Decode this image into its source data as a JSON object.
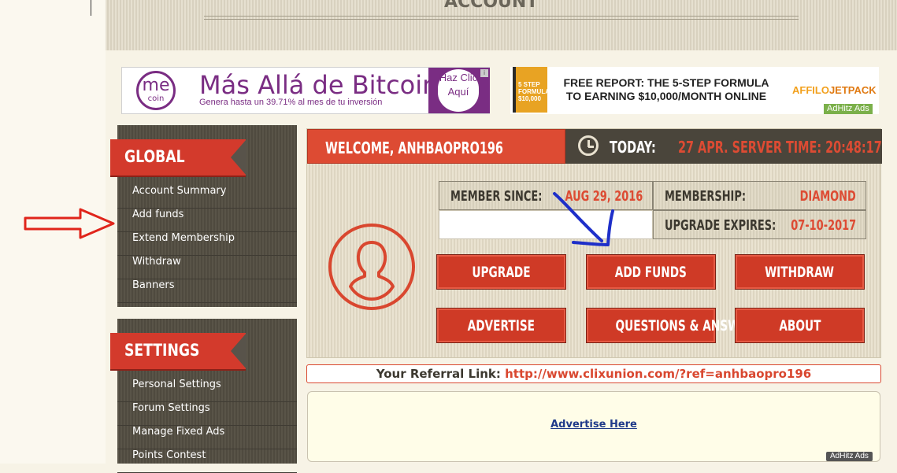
{
  "header": {
    "partial_title": "ACCOUNT"
  },
  "banner_left": {
    "logo_top": "me",
    "logo_bottom": "coin",
    "title": "Más Allá de Bitcoin",
    "subtitle": "Genera hasta un 39.71% al mes de tu inversión",
    "cta": "Haz Clic Aquí"
  },
  "banner_right": {
    "book_text": "5 STEP FORMULA $10,000",
    "headline_line1": "FREE REPORT: THE 5-STEP FORMULA",
    "headline_line2": "TO EARNING $10,000/MONTH ONLINE",
    "brand_left": "AFFILO",
    "brand_right": "JETPACK",
    "badge": "AdHitz Ads"
  },
  "sidebar": {
    "global_title": "GLOBAL",
    "global_items": [
      "Account Summary",
      "Add funds",
      "Extend Membership",
      "Withdraw",
      "Banners"
    ],
    "settings_title": "SETTINGS",
    "settings_items": [
      "Personal Settings",
      "Forum Settings",
      "Manage Fixed Ads",
      "Points Contest"
    ]
  },
  "main": {
    "welcome": "WELCOME, ANHBAOPRO196",
    "today_label": "TODAY:",
    "server_time": "27 APR. SERVER TIME: 20:48:17",
    "member_since_label": "MEMBER SINCE:",
    "member_since_value": "AUG 29, 2016",
    "membership_label": "MEMBERSHIP:",
    "membership_value": "DIAMOND",
    "upgrade_expires_label": "UPGRADE EXPIRES:",
    "upgrade_expires_value": "07-10-2017",
    "buttons": [
      "UPGRADE",
      "ADD FUNDS",
      "WITHDRAW",
      "ADVERTISE",
      "QUESTIONS & ANSWERS",
      "ABOUT"
    ]
  },
  "referral": {
    "label": "Your Referral Link:",
    "url": "http://www.clixunion.com/?ref=anhbaopro196"
  },
  "ad_box": {
    "link": "Advertise Here",
    "badge": "AdHitz Ads"
  },
  "colors": {
    "accent": "#dd4b33",
    "dark": "#4a453b",
    "purple": "#7a2d83"
  }
}
